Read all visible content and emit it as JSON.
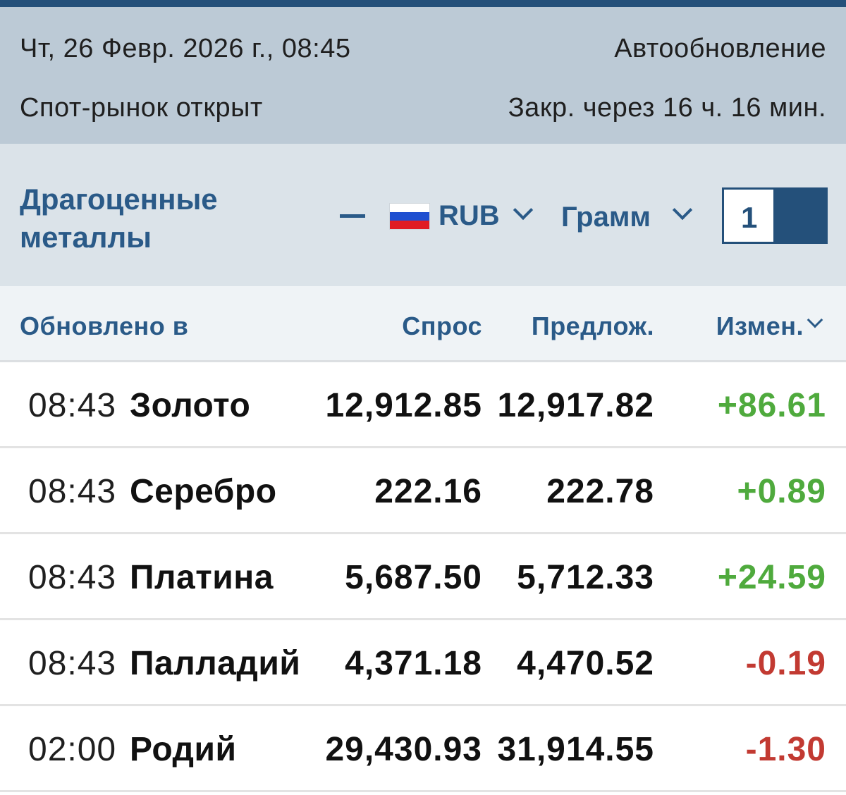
{
  "status": {
    "datetime": "Чт, 26 Февр. 2026 г., 08:45",
    "auto_update": "Автообновление",
    "market_status": "Спот-рынок открыт",
    "close_in": "Закр. через 16 ч. 16 мин."
  },
  "controls": {
    "category": "Драгоценные металлы",
    "currency": "RUB",
    "currency_flag": "russia-flag-icon",
    "unit": "Грамм",
    "quantity": "1"
  },
  "columns": {
    "updated": "Обновлено в",
    "bid": "Спрос",
    "ask": "Предлож.",
    "change": "Измен."
  },
  "rows": [
    {
      "time": "08:43",
      "name": "Золото",
      "bid": "12,912.85",
      "ask": "12,917.82",
      "change": "+86.61",
      "trend": "up"
    },
    {
      "time": "08:43",
      "name": "Серебро",
      "bid": "222.16",
      "ask": "222.78",
      "change": "+0.89",
      "trend": "up"
    },
    {
      "time": "08:43",
      "name": "Платина",
      "bid": "5,687.50",
      "ask": "5,712.33",
      "change": "+24.59",
      "trend": "up"
    },
    {
      "time": "08:43",
      "name": "Палладий",
      "bid": "4,371.18",
      "ask": "4,470.52",
      "change": "-0.19",
      "trend": "down"
    },
    {
      "time": "02:00",
      "name": "Родий",
      "bid": "29,430.93",
      "ask": "31,914.55",
      "change": "-1.30",
      "trend": "down"
    }
  ],
  "colors": {
    "accent": "#2a5a88",
    "header_dark": "#24507a",
    "status_bg": "#bccad6",
    "controls_bg": "#dbe3e9",
    "positive": "#4faa3d",
    "negative": "#c23a32"
  }
}
